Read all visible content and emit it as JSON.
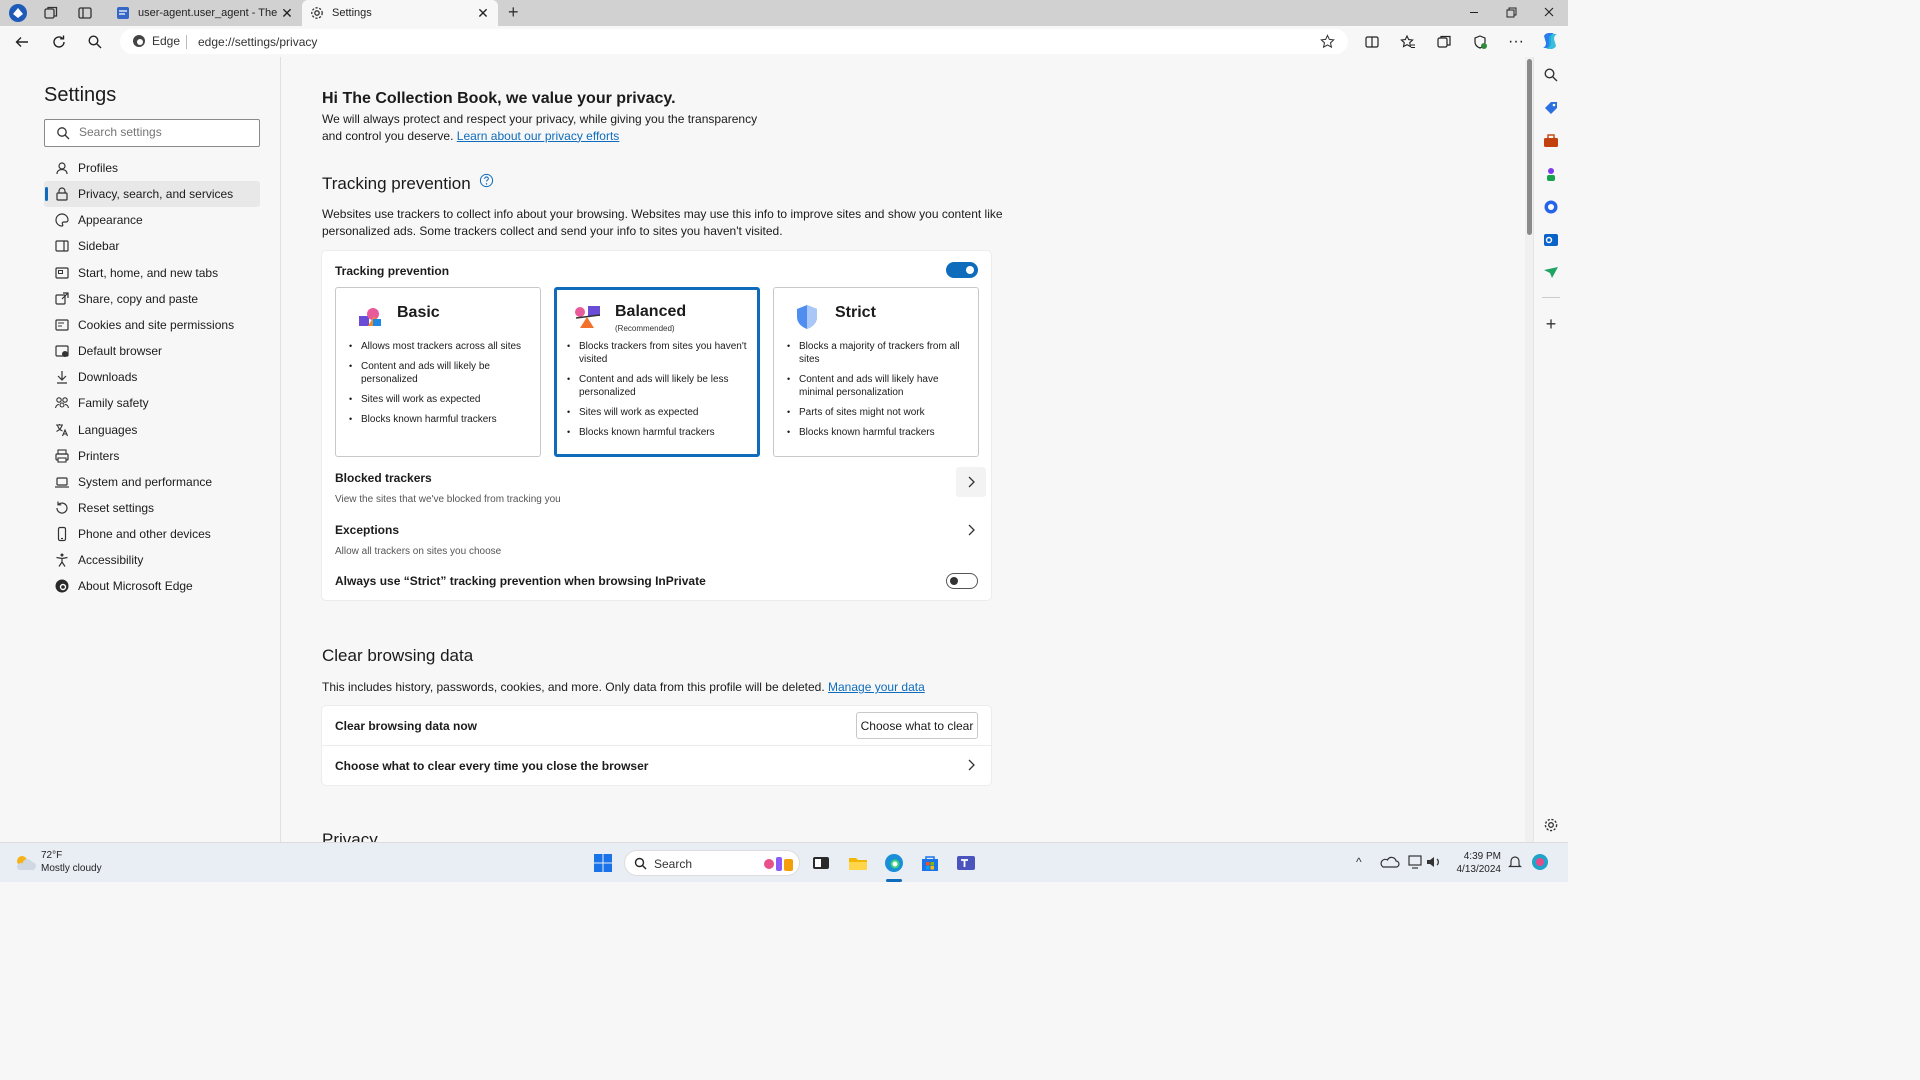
{
  "tabs": [
    {
      "title": "user-agent.user_agent - The Colle",
      "active": false
    },
    {
      "title": "Settings",
      "active": true
    }
  ],
  "address": {
    "site_label": "Edge",
    "url": "edge://settings/privacy"
  },
  "sidebar": {
    "title": "Settings",
    "search_placeholder": "Search settings",
    "items": [
      {
        "label": "Profiles",
        "icon": "profile-icon"
      },
      {
        "label": "Privacy, search, and services",
        "icon": "lock-icon",
        "selected": true
      },
      {
        "label": "Appearance",
        "icon": "appearance-icon"
      },
      {
        "label": "Sidebar",
        "icon": "sidebar-icon"
      },
      {
        "label": "Start, home, and new tabs",
        "icon": "home-icon"
      },
      {
        "label": "Share, copy and paste",
        "icon": "share-icon"
      },
      {
        "label": "Cookies and site permissions",
        "icon": "cookies-icon"
      },
      {
        "label": "Default browser",
        "icon": "browser-icon"
      },
      {
        "label": "Downloads",
        "icon": "download-icon"
      },
      {
        "label": "Family safety",
        "icon": "family-icon"
      },
      {
        "label": "Languages",
        "icon": "language-icon"
      },
      {
        "label": "Printers",
        "icon": "printer-icon"
      },
      {
        "label": "System and performance",
        "icon": "laptop-icon"
      },
      {
        "label": "Reset settings",
        "icon": "reset-icon"
      },
      {
        "label": "Phone and other devices",
        "icon": "phone-icon"
      },
      {
        "label": "Accessibility",
        "icon": "accessibility-icon"
      },
      {
        "label": "About Microsoft Edge",
        "icon": "edge-logo-icon"
      }
    ]
  },
  "main": {
    "greeting": "Hi The Collection Book, we value your privacy.",
    "intro_line1": "We will always protect and respect your privacy, while giving you the transparency",
    "intro_line2": "and control you deserve.",
    "intro_link": "Learn about our privacy efforts",
    "tracking": {
      "heading": "Tracking prevention",
      "desc_line1": "Websites use trackers to collect info about your browsing. Websites may use this info to improve sites and show you content like",
      "desc_line2": "personalized ads. Some trackers collect and send your info to sites you haven't visited.",
      "toggle_label": "Tracking prevention",
      "toggle_on": true,
      "levels": [
        {
          "name": "Basic",
          "subtitle": "",
          "selected": false,
          "bullets": [
            "Allows most trackers across all sites",
            "Content and ads will likely be personalized",
            "Sites will work as expected",
            "Blocks known harmful trackers"
          ]
        },
        {
          "name": "Balanced",
          "subtitle": "(Recommended)",
          "selected": true,
          "bullets": [
            "Blocks trackers from sites you haven't visited",
            "Content and ads will likely be less personalized",
            "Sites will work as expected",
            "Blocks known harmful trackers"
          ]
        },
        {
          "name": "Strict",
          "subtitle": "",
          "selected": false,
          "bullets": [
            "Blocks a majority of trackers from all sites",
            "Content and ads will likely have minimal personalization",
            "Parts of sites might not work",
            "Blocks known harmful trackers"
          ]
        }
      ],
      "blocked_title": "Blocked trackers",
      "blocked_sub": "View the sites that we've blocked from tracking you",
      "exceptions_title": "Exceptions",
      "exceptions_sub": "Allow all trackers on sites you choose",
      "inprivate_label": "Always use “Strict” tracking prevention when browsing InPrivate",
      "inprivate_on": false
    },
    "clear": {
      "heading": "Clear browsing data",
      "desc": "This includes history, passwords, cookies, and more. Only data from this profile will be deleted.",
      "desc_link": "Manage your data",
      "now_label": "Clear browsing data now",
      "now_button": "Choose what to clear",
      "every_time_label": "Choose what to clear every time you close the browser"
    },
    "next_heading": "Privacy"
  },
  "taskbar": {
    "weather_temp": "72°F",
    "weather_desc": "Mostly cloudy",
    "search_label": "Search",
    "time": "4:39 PM",
    "date": "4/13/2024"
  },
  "colors": {
    "accent": "#0f6cbd",
    "selected_bg": "#e8e8e8"
  }
}
